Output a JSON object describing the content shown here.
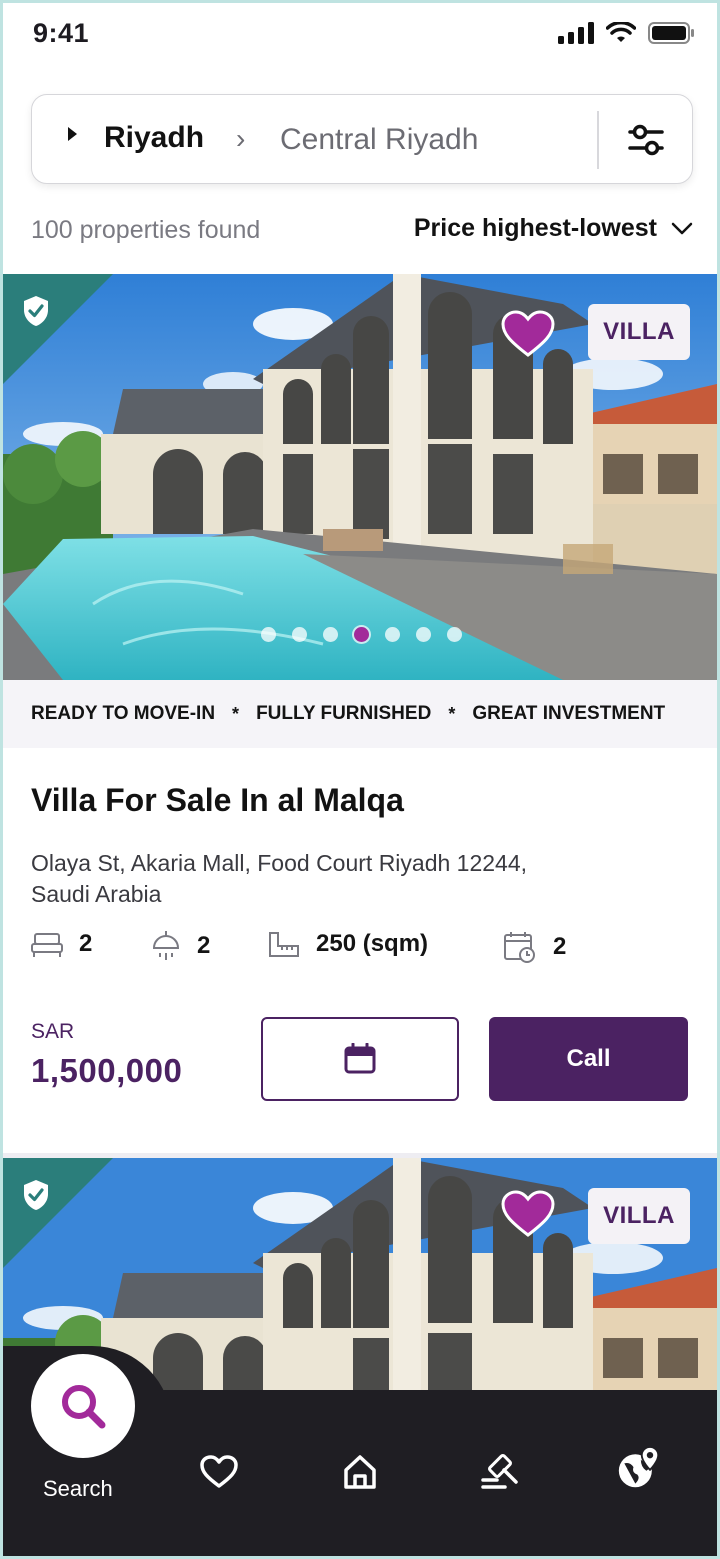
{
  "status_bar": {
    "time": "9:41"
  },
  "search_bar": {
    "city": "Riyadh",
    "area": "Central Riyadh"
  },
  "results": {
    "count_text": "100 properties found",
    "sort_label": "Price highest-lowest"
  },
  "listings": [
    {
      "type": "VILLA",
      "verified": true,
      "favorited": true,
      "carousel": {
        "total": 7,
        "active_index": 3
      },
      "tags": [
        "READY TO MOVE-IN",
        "FULLY FURNISHED",
        "GREAT INVESTMENT"
      ],
      "tag_separator": "*",
      "title": "Villa For Sale In al Malqa",
      "address": "Olaya St, Akaria Mall, Food Court Riyadh 12244, Saudi Arabia",
      "features": {
        "bedrooms": "2",
        "bathrooms": "2",
        "area": "250 (sqm)",
        "year": "2"
      },
      "currency": "SAR",
      "price": "1,500,000",
      "call_label": "Call"
    },
    {
      "type": "VILLA",
      "verified": true,
      "favorited": true
    }
  ],
  "bottom_nav": {
    "search_label": "Search"
  },
  "colors": {
    "brand": "#4b2262",
    "accent": "#a22a9a",
    "verified": "#2b7e7b",
    "nav_bg": "#1f1e23"
  }
}
